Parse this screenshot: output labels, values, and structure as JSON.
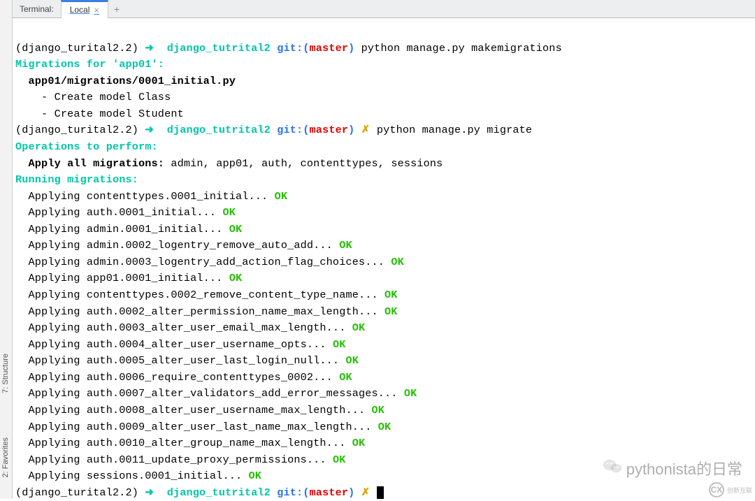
{
  "tabbar": {
    "title": "Terminal:",
    "active_tab": "Local",
    "close_glyph": "×",
    "plus_glyph": "+"
  },
  "side": {
    "structure": "7: Structure",
    "favorites": "2: Favorites"
  },
  "prompt": {
    "venv": "(django_turital2.2)",
    "arrow": "➜",
    "dir": "django_tutrital2",
    "git": "git:",
    "lparen": "(",
    "branch": "master",
    "rparen": ")",
    "dirty": "✗"
  },
  "cmds": {
    "makemigrations": "python manage.py makemigrations",
    "migrate": "python manage.py migrate"
  },
  "mig_header": "Migrations for 'app01':",
  "mig_file": "  app01/migrations/0001_initial.py",
  "mig_actions": [
    "    - Create model Class",
    "    - Create model Student"
  ],
  "ops_header": "Operations to perform:",
  "ops_line_label": "  Apply all migrations:",
  "ops_line_rest": " admin, app01, auth, contenttypes, sessions",
  "run_header": "Running migrations:",
  "ok": "OK",
  "applying": [
    "  Applying contenttypes.0001_initial... ",
    "  Applying auth.0001_initial... ",
    "  Applying admin.0001_initial... ",
    "  Applying admin.0002_logentry_remove_auto_add... ",
    "  Applying admin.0003_logentry_add_action_flag_choices... ",
    "  Applying app01.0001_initial... ",
    "  Applying contenttypes.0002_remove_content_type_name... ",
    "  Applying auth.0002_alter_permission_name_max_length... ",
    "  Applying auth.0003_alter_user_email_max_length... ",
    "  Applying auth.0004_alter_user_username_opts... ",
    "  Applying auth.0005_alter_user_last_login_null... ",
    "  Applying auth.0006_require_contenttypes_0002... ",
    "  Applying auth.0007_alter_validators_add_error_messages... ",
    "  Applying auth.0008_alter_user_username_max_length... ",
    "  Applying auth.0009_alter_user_last_name_max_length... ",
    "  Applying auth.0010_alter_group_name_max_length... ",
    "  Applying auth.0011_update_proxy_permissions... ",
    "  Applying sessions.0001_initial... "
  ],
  "watermark": "pythonista的日常",
  "corner": "创新互联"
}
